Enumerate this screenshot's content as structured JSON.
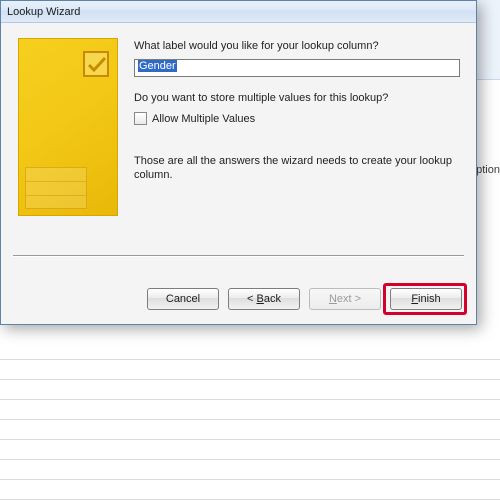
{
  "background": {
    "column_header": "scription"
  },
  "dialog": {
    "title": "Lookup Wizard",
    "label_question": "What label would you like for your lookup column?",
    "label_value": "Gender",
    "multi_question": "Do you want to store multiple values for this lookup?",
    "allow_multi_prefix": "A",
    "allow_multi_rest": "llow Multiple Values",
    "final_text": "Those are all the answers the wizard needs to create your lookup column.",
    "buttons": {
      "cancel": "Cancel",
      "back_lt": "< ",
      "back_u": "B",
      "back_rest": "ack",
      "next_u": "N",
      "next_rest": "ext >",
      "finish_u": "F",
      "finish_rest": "inish"
    }
  }
}
